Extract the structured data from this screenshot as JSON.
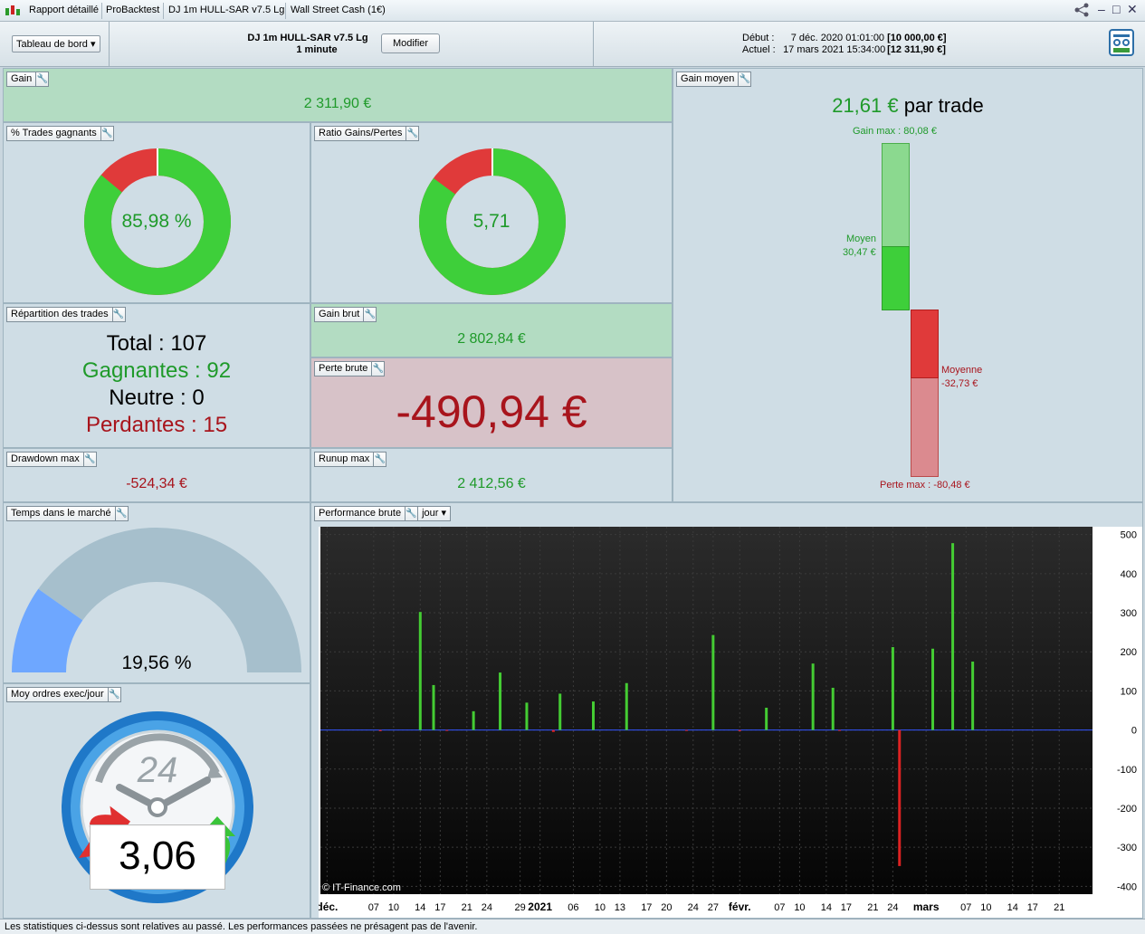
{
  "titlebar": {
    "tabs": [
      "Rapport détaillé",
      "ProBacktest",
      "DJ 1m HULL-SAR v7.5 Lg",
      "Wall Street Cash (1€)"
    ]
  },
  "header": {
    "dashboard_label": "Tableau de bord",
    "strategy_name": "DJ 1m HULL-SAR v7.5 Lg",
    "timeframe": "1 minute",
    "modify_label": "Modifier",
    "start_label": "Début :",
    "start_date": "7 déc. 2020 01:01:00",
    "start_capital": "[10 000,00 €]",
    "current_label": "Actuel :",
    "current_date": "17 mars 2021 15:34:00",
    "current_capital": "[12 311,90 €]"
  },
  "gain": {
    "title": "Gain",
    "value": "2 311,90 €"
  },
  "win_pct": {
    "title": "% Trades gagnants",
    "value": "85,98 %",
    "fraction": 0.8598
  },
  "ratio": {
    "title": "Ratio Gains/Pertes",
    "value": "5,71",
    "fraction": 0.851
  },
  "avg_gain": {
    "title": "Gain moyen",
    "value": "21,61 €",
    "suffix": "par trade",
    "max_gain": "Gain max : 80,08 €",
    "avg_pos_label": "Moyen",
    "avg_pos_value": "30,47 €",
    "avg_neg_label": "Moyenne",
    "avg_neg_value": "-32,73 €",
    "max_loss": "Perte max : -80,48 €",
    "max_gain_num": 80.08,
    "avg_pos_num": 30.47,
    "avg_neg_num": -32.73,
    "max_loss_num": -80.48
  },
  "distribution": {
    "title": "Répartition des trades",
    "total_label": "Total :",
    "total": "107",
    "win_label": "Gagnantes :",
    "win": "92",
    "neutral_label": "Neutre :",
    "neutral": "0",
    "loss_label": "Perdantes :",
    "loss": "15"
  },
  "gross_gain": {
    "title": "Gain brut",
    "value": "2 802,84 €"
  },
  "gross_loss": {
    "title": "Perte brute",
    "value": "-490,94 €"
  },
  "drawdown": {
    "title": "Drawdown max",
    "value": "-524,34 €"
  },
  "runup": {
    "title": "Runup max",
    "value": "2 412,56 €"
  },
  "time_in_market": {
    "title": "Temps dans le marché",
    "value": "19,56 %",
    "fraction": 0.1956
  },
  "orders": {
    "title": "Moy ordres exec/jour",
    "value": "3,06",
    "clock_label": "24"
  },
  "performance": {
    "title": "Performance brute",
    "period": "jour",
    "copyright": "© IT-Finance.com"
  },
  "chart_data": {
    "type": "bar",
    "title": "Performance brute",
    "ylim": [
      -420,
      520
    ],
    "yticks": [
      500,
      400,
      300,
      200,
      100,
      0,
      -100,
      -200,
      -300,
      -400
    ],
    "xlabels": [
      {
        "label": "déc.",
        "day": 0,
        "bold": true
      },
      {
        "label": "07",
        "day": 7
      },
      {
        "label": "10",
        "day": 10
      },
      {
        "label": "14",
        "day": 14
      },
      {
        "label": "17",
        "day": 17
      },
      {
        "label": "21",
        "day": 21
      },
      {
        "label": "24",
        "day": 24
      },
      {
        "label": "29",
        "day": 29
      },
      {
        "label": "2021",
        "day": 32,
        "bold": true
      },
      {
        "label": "06",
        "day": 37
      },
      {
        "label": "10",
        "day": 41
      },
      {
        "label": "13",
        "day": 44
      },
      {
        "label": "17",
        "day": 48
      },
      {
        "label": "20",
        "day": 51
      },
      {
        "label": "24",
        "day": 55
      },
      {
        "label": "27",
        "day": 58
      },
      {
        "label": "févr.",
        "day": 62,
        "bold": true
      },
      {
        "label": "07",
        "day": 68
      },
      {
        "label": "10",
        "day": 71
      },
      {
        "label": "14",
        "day": 75
      },
      {
        "label": "17",
        "day": 78
      },
      {
        "label": "21",
        "day": 82
      },
      {
        "label": "24",
        "day": 85
      },
      {
        "label": "mars",
        "day": 90,
        "bold": true
      },
      {
        "label": "07",
        "day": 96
      },
      {
        "label": "10",
        "day": 99
      },
      {
        "label": "14",
        "day": 103
      },
      {
        "label": "17",
        "day": 106
      },
      {
        "label": "21",
        "day": 110
      }
    ],
    "bars": [
      {
        "day": 8,
        "value": -3
      },
      {
        "day": 14,
        "value": 302
      },
      {
        "day": 16,
        "value": 115
      },
      {
        "day": 18,
        "value": -2
      },
      {
        "day": 22,
        "value": 48
      },
      {
        "day": 26,
        "value": 147
      },
      {
        "day": 30,
        "value": 70
      },
      {
        "day": 34,
        "value": -5
      },
      {
        "day": 35,
        "value": 93
      },
      {
        "day": 40,
        "value": 73
      },
      {
        "day": 45,
        "value": 120
      },
      {
        "day": 54,
        "value": -2
      },
      {
        "day": 58,
        "value": 243
      },
      {
        "day": 62,
        "value": -3
      },
      {
        "day": 66,
        "value": 57
      },
      {
        "day": 73,
        "value": 170
      },
      {
        "day": 76,
        "value": 108
      },
      {
        "day": 77,
        "value": -2
      },
      {
        "day": 85,
        "value": 212
      },
      {
        "day": 86,
        "value": -348
      },
      {
        "day": 91,
        "value": 208
      },
      {
        "day": 94,
        "value": 478
      },
      {
        "day": 97,
        "value": 175
      }
    ],
    "xrange": [
      -1,
      115
    ],
    "colors": {
      "positive": "#44cc33",
      "negative": "#dd2222",
      "zero_line": "#3355ff",
      "background": "#111111",
      "grid": "#3a3a3a"
    }
  },
  "footer": {
    "disclaimer": "Les statistiques ci-dessus sont relatives au passé. Les performances passées ne présagent pas de l'avenir."
  },
  "colors": {
    "green": "#3ecf3a",
    "red": "#e03a3a",
    "gauge_blue": "#6ea7ff",
    "gauge_gray": "#a6bfcc"
  }
}
